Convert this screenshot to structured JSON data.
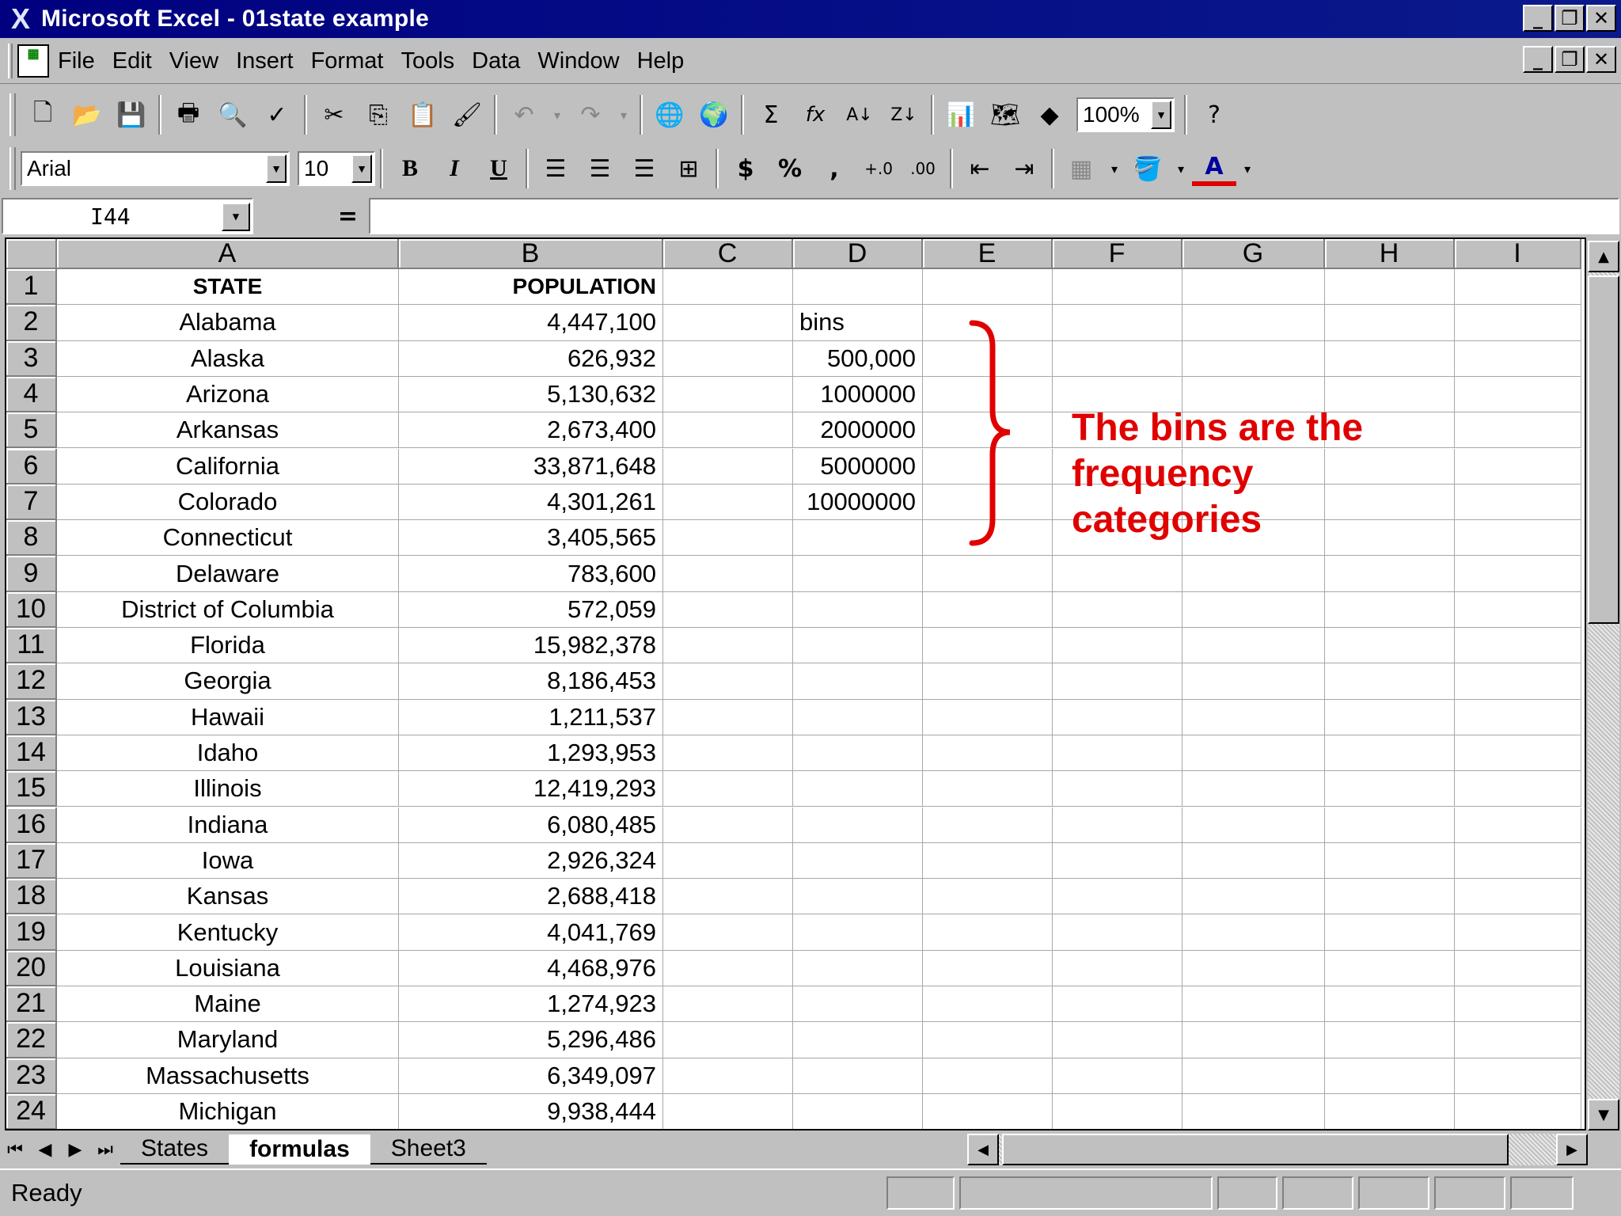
{
  "window": {
    "title": "Microsoft Excel - 01state example",
    "controls": [
      "_",
      "❐",
      "✕"
    ]
  },
  "menu": [
    "File",
    "Edit",
    "View",
    "Insert",
    "Format",
    "Tools",
    "Data",
    "Window",
    "Help"
  ],
  "toolbar": {
    "zoom": "100%",
    "font": "Arial",
    "size": "10",
    "bold": "B",
    "italic": "I",
    "underline": "U",
    "currency": "$",
    "percent": "%",
    "comma": ",",
    "autosum": "Σ",
    "function": "fx"
  },
  "formula_bar": {
    "cell_ref": "I44",
    "equals": "=",
    "content": ""
  },
  "columns": [
    "A",
    "B",
    "C",
    "D",
    "E",
    "F",
    "G",
    "H",
    "I"
  ],
  "rows": [
    {
      "n": "1",
      "a": "STATE",
      "b": "POPULATION",
      "d": ""
    },
    {
      "n": "2",
      "a": "Alabama",
      "b": "4,447,100",
      "d": "bins"
    },
    {
      "n": "3",
      "a": "Alaska",
      "b": "626,932",
      "d": "500,000"
    },
    {
      "n": "4",
      "a": "Arizona",
      "b": "5,130,632",
      "d": "1000000"
    },
    {
      "n": "5",
      "a": "Arkansas",
      "b": "2,673,400",
      "d": "2000000"
    },
    {
      "n": "6",
      "a": "California",
      "b": "33,871,648",
      "d": "5000000"
    },
    {
      "n": "7",
      "a": "Colorado",
      "b": "4,301,261",
      "d": "10000000"
    },
    {
      "n": "8",
      "a": "Connecticut",
      "b": "3,405,565",
      "d": ""
    },
    {
      "n": "9",
      "a": "Delaware",
      "b": "783,600",
      "d": ""
    },
    {
      "n": "10",
      "a": "District of Columbia",
      "b": "572,059",
      "d": ""
    },
    {
      "n": "11",
      "a": "Florida",
      "b": "15,982,378",
      "d": ""
    },
    {
      "n": "12",
      "a": "Georgia",
      "b": "8,186,453",
      "d": ""
    },
    {
      "n": "13",
      "a": "Hawaii",
      "b": "1,211,537",
      "d": ""
    },
    {
      "n": "14",
      "a": "Idaho",
      "b": "1,293,953",
      "d": ""
    },
    {
      "n": "15",
      "a": "Illinois",
      "b": "12,419,293",
      "d": ""
    },
    {
      "n": "16",
      "a": "Indiana",
      "b": "6,080,485",
      "d": ""
    },
    {
      "n": "17",
      "a": "Iowa",
      "b": "2,926,324",
      "d": ""
    },
    {
      "n": "18",
      "a": "Kansas",
      "b": "2,688,418",
      "d": ""
    },
    {
      "n": "19",
      "a": "Kentucky",
      "b": "4,041,769",
      "d": ""
    },
    {
      "n": "20",
      "a": "Louisiana",
      "b": "4,468,976",
      "d": ""
    },
    {
      "n": "21",
      "a": "Maine",
      "b": "1,274,923",
      "d": ""
    },
    {
      "n": "22",
      "a": "Maryland",
      "b": "5,296,486",
      "d": ""
    },
    {
      "n": "23",
      "a": "Massachusetts",
      "b": "6,349,097",
      "d": ""
    },
    {
      "n": "24",
      "a": "Michigan",
      "b": "9,938,444",
      "d": ""
    }
  ],
  "annotation": {
    "text": "The bins are the frequency categories",
    "color": "#e00000"
  },
  "sheets": [
    "States",
    "formulas",
    "Sheet3"
  ],
  "active_sheet": "formulas",
  "status": "Ready"
}
